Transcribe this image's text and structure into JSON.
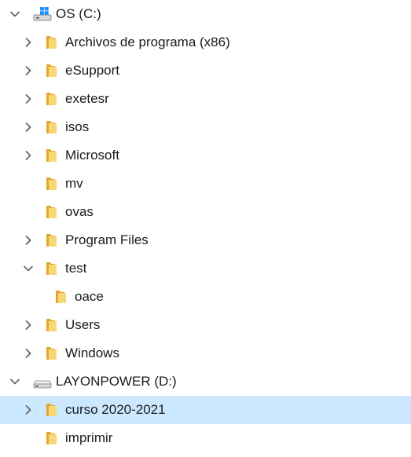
{
  "tree": {
    "rows": [
      {
        "id": "drive-c",
        "label": "OS (C:)",
        "level": 0,
        "expander": "expanded",
        "icon": "windows-drive-icon",
        "selected": false
      },
      {
        "id": "archivos-x86",
        "label": "Archivos de programa (x86)",
        "level": 1,
        "expander": "collapsed",
        "icon": "folder-icon",
        "selected": false
      },
      {
        "id": "esupport",
        "label": "eSupport",
        "level": 1,
        "expander": "collapsed",
        "icon": "folder-icon",
        "selected": false
      },
      {
        "id": "exetesr",
        "label": "exetesr",
        "level": 1,
        "expander": "collapsed",
        "icon": "folder-icon",
        "selected": false
      },
      {
        "id": "isos",
        "label": "isos",
        "level": 1,
        "expander": "collapsed",
        "icon": "folder-icon",
        "selected": false
      },
      {
        "id": "microsoft",
        "label": "Microsoft",
        "level": 1,
        "expander": "collapsed",
        "icon": "folder-icon",
        "selected": false
      },
      {
        "id": "mv",
        "label": "mv",
        "level": 1,
        "expander": "none",
        "icon": "folder-icon",
        "selected": false
      },
      {
        "id": "ovas",
        "label": "ovas",
        "level": 1,
        "expander": "none",
        "icon": "folder-icon",
        "selected": false
      },
      {
        "id": "program-files",
        "label": "Program Files",
        "level": 1,
        "expander": "collapsed",
        "icon": "folder-icon",
        "selected": false
      },
      {
        "id": "test",
        "label": "test",
        "level": 1,
        "expander": "expanded",
        "icon": "folder-icon",
        "selected": false
      },
      {
        "id": "oace",
        "label": "oace",
        "level": 2,
        "expander": "none",
        "icon": "folder-icon",
        "selected": false
      },
      {
        "id": "users",
        "label": "Users",
        "level": 1,
        "expander": "collapsed",
        "icon": "folder-icon",
        "selected": false
      },
      {
        "id": "windows",
        "label": "Windows",
        "level": 1,
        "expander": "collapsed",
        "icon": "folder-icon",
        "selected": false
      },
      {
        "id": "drive-d",
        "label": "LAYONPOWER (D:)",
        "level": 0,
        "expander": "expanded",
        "icon": "drive-icon",
        "selected": false
      },
      {
        "id": "curso-2020-2021",
        "label": "curso 2020-2021",
        "level": 1,
        "expander": "collapsed",
        "icon": "folder-icon",
        "selected": true
      },
      {
        "id": "imprimir",
        "label": "imprimir",
        "level": 1,
        "expander": "none",
        "icon": "folder-icon",
        "selected": false
      }
    ]
  },
  "colors": {
    "selection": "#cce8ff",
    "folder": "#f8d775",
    "folder_dark": "#e0a82e",
    "chevron": "#5f5f5f",
    "text": "#1a1a1a"
  }
}
